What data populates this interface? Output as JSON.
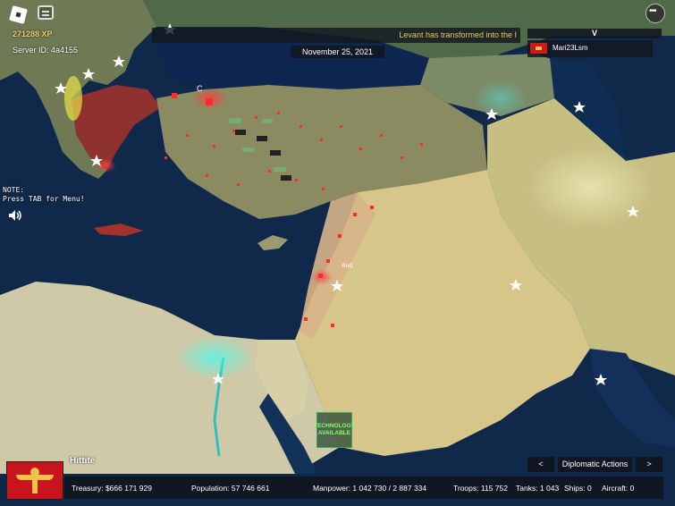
{
  "hud": {
    "xp": "271288 XP",
    "server_id": "Server ID: 4a4155",
    "ticker": "Levant has transformed into the I",
    "date": "November 25, 2021",
    "note_line1": "NOTE:",
    "note_line2": "Press TAB for Menu!"
  },
  "players_panel": {
    "header": "V",
    "player_name": "Mari23Lsm"
  },
  "map": {
    "city_label_c": "C",
    "city_label_aud": "Aud",
    "tech_notice": "TECHNOLOGY AVAILABLE"
  },
  "country": {
    "name": "Hittite",
    "flag_colors": {
      "field": "#c8141c",
      "emblem": "#f1c24a"
    }
  },
  "stats": {
    "treasury": "Treasury:  $666 171 929",
    "population": "Population: 57 746 661",
    "manpower": "Manpower:  1 042 730  /  2 887 334",
    "troops": "Troops: 115 752",
    "tanks": "Tanks: 1 043",
    "ships": "Ships: 0",
    "aircraft": "Aircraft: 0"
  },
  "buttons": {
    "prev": "<",
    "diplomatic": "Diplomatic Actions",
    "next": ">"
  },
  "colors": {
    "sea": "#0d2440",
    "player_territory": "#d01818",
    "ticker_text": "#f0c658"
  }
}
